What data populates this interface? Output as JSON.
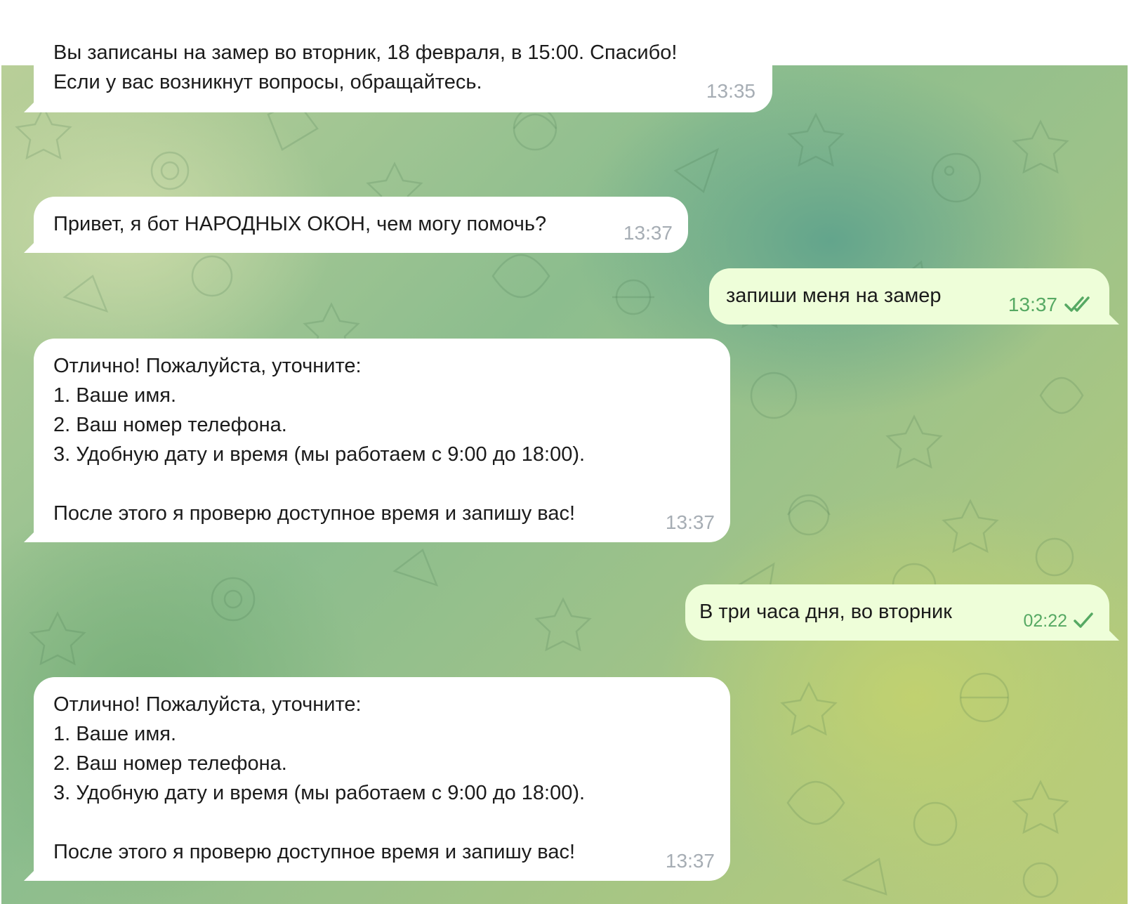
{
  "messages": [
    {
      "dir": "in",
      "text": "Вы записаны на замер во вторник, 18 февраля, в 15:00. Спасибо!\nЕсли у вас возникнут вопросы, обращайтесь.",
      "time": "13:35"
    },
    {
      "dir": "in",
      "text": "Привет, я бот НАРОДНЫХ ОКОН, чем могу помочь?",
      "time": "13:37"
    },
    {
      "dir": "out",
      "text": "запиши меня на замер",
      "time": "13:37",
      "status": "double-check-icon"
    },
    {
      "dir": "in",
      "text": "Отлично! Пожалуйста, уточните:\n1. Ваше имя.\n2. Ваш номер телефона.\n3. Удобную дату и время (мы работаем с 9:00 до 18:00).\n\nПосле этого я проверю доступное время и запишу вас!",
      "time": "13:37"
    },
    {
      "dir": "out",
      "text": "В три часа дня, во вторник",
      "time": "02:22",
      "status": "single-check-icon"
    },
    {
      "dir": "in",
      "text": "Отлично! Пожалуйста, уточните:\n1. Ваше имя.\n2. Ваш номер телефона.\n3. Удобную дату и время (мы работаем с 9:00 до 18:00).\n\nПосле этого я проверю доступное время и запишу вас!",
      "time": "13:37"
    }
  ],
  "colors": {
    "incoming_bubble": "#ffffff",
    "outgoing_bubble": "#eefed9",
    "outgoing_time": "#56a963",
    "incoming_time": "#a6adb4"
  }
}
